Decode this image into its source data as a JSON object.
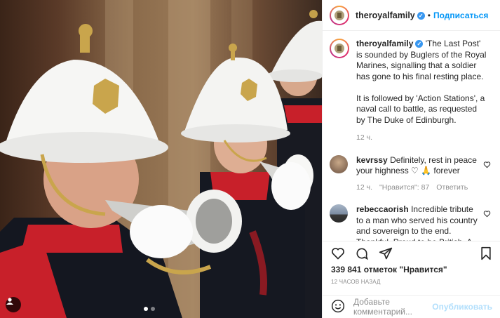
{
  "post": {
    "username": "theroyalfamily",
    "follow_label": "Подписаться",
    "separator": "•",
    "caption_user": "theroyalfamily",
    "caption_p1": "'The Last Post' is sounded by Buglers of the Royal Marines, signalling that a soldier has gone to his final resting place.",
    "caption_p2": "It is followed by 'Action Stations', a naval call to battle, as requested by The Duke of Edinburgh.",
    "caption_time": "12 ч."
  },
  "comments": [
    {
      "user": "kevrssy",
      "text": "Definitely, rest in peace your highness ♡ 🙏 forever",
      "time": "12 ч.",
      "likes": "\"Нравится\": 87",
      "reply": "Ответить"
    },
    {
      "user": "rebeccaorish",
      "text": "Incredible tribute to a man who served his country and sovereign to the end. Thankful. Proud to be British. A"
    }
  ],
  "stats": {
    "likes": "339 841 отметок \"Нравится\"",
    "posted_ago": "12 ЧАСОВ НАЗАД"
  },
  "add_comment": {
    "placeholder": "Добавьте комментарий...",
    "publish": "Опубликовать"
  },
  "colors": {
    "accent": "#0095f6",
    "verified": "#3897f0",
    "muted": "#8e8e8e",
    "tunic_red": "#c8202a"
  },
  "icons": [
    "heart-icon",
    "comment-icon",
    "share-icon",
    "bookmark-icon",
    "emoji-icon",
    "verified-icon",
    "user-tag-icon"
  ]
}
